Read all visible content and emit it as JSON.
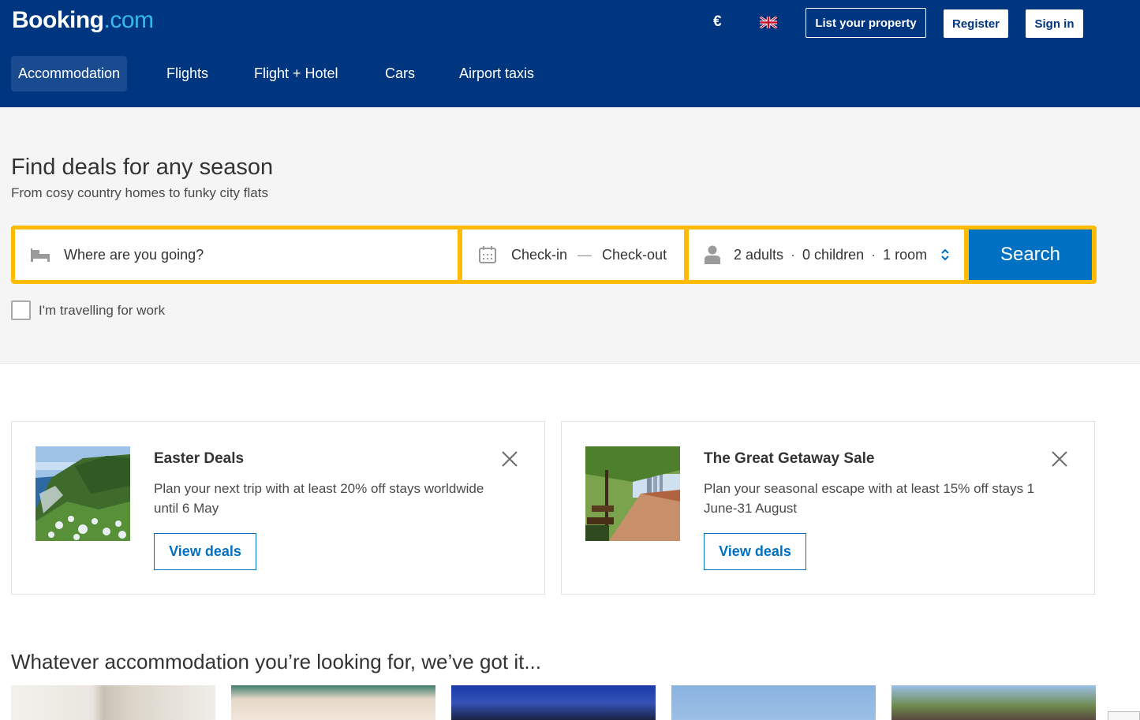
{
  "header": {
    "logo_brand": "Booking",
    "logo_suffix": ".com",
    "currency": "€",
    "language_icon": "uk-flag-icon",
    "list_property": "List your property",
    "register": "Register",
    "sign_in": "Sign in"
  },
  "nav": {
    "items": [
      "Accommodation",
      "Flights",
      "Flight + Hotel",
      "Cars",
      "Airport taxis"
    ],
    "active": "Accommodation"
  },
  "hero": {
    "title": "Find deals for any season",
    "subtitle": "From cosy country homes to funky city flats"
  },
  "search": {
    "destination_placeholder": "Where are you going?",
    "checkin": "Check-in",
    "checkout": "Check-out",
    "date_separator": "—",
    "adults": "2 adults",
    "children": "0 children",
    "rooms": "1 room",
    "dot": "·",
    "button": "Search",
    "work_label": "I'm travelling for work",
    "work_checked": false
  },
  "promos": [
    {
      "title": "Easter Deals",
      "description": "Plan your next trip with at least 20% off stays worldwide until 6 May",
      "button": "View deals"
    },
    {
      "title": "The Great Getaway Sale",
      "description": "Plan your seasonal escape with at least 15% off stays 1 June-31 August",
      "button": "View deals"
    }
  ],
  "accommodation": {
    "title": "Whatever accommodation you’re looking for, we’ve got it..."
  },
  "colors": {
    "header_bg": "#003580",
    "search_border": "#febb02",
    "search_button": "#0071c2",
    "logo_dot": "#35b9ed"
  }
}
